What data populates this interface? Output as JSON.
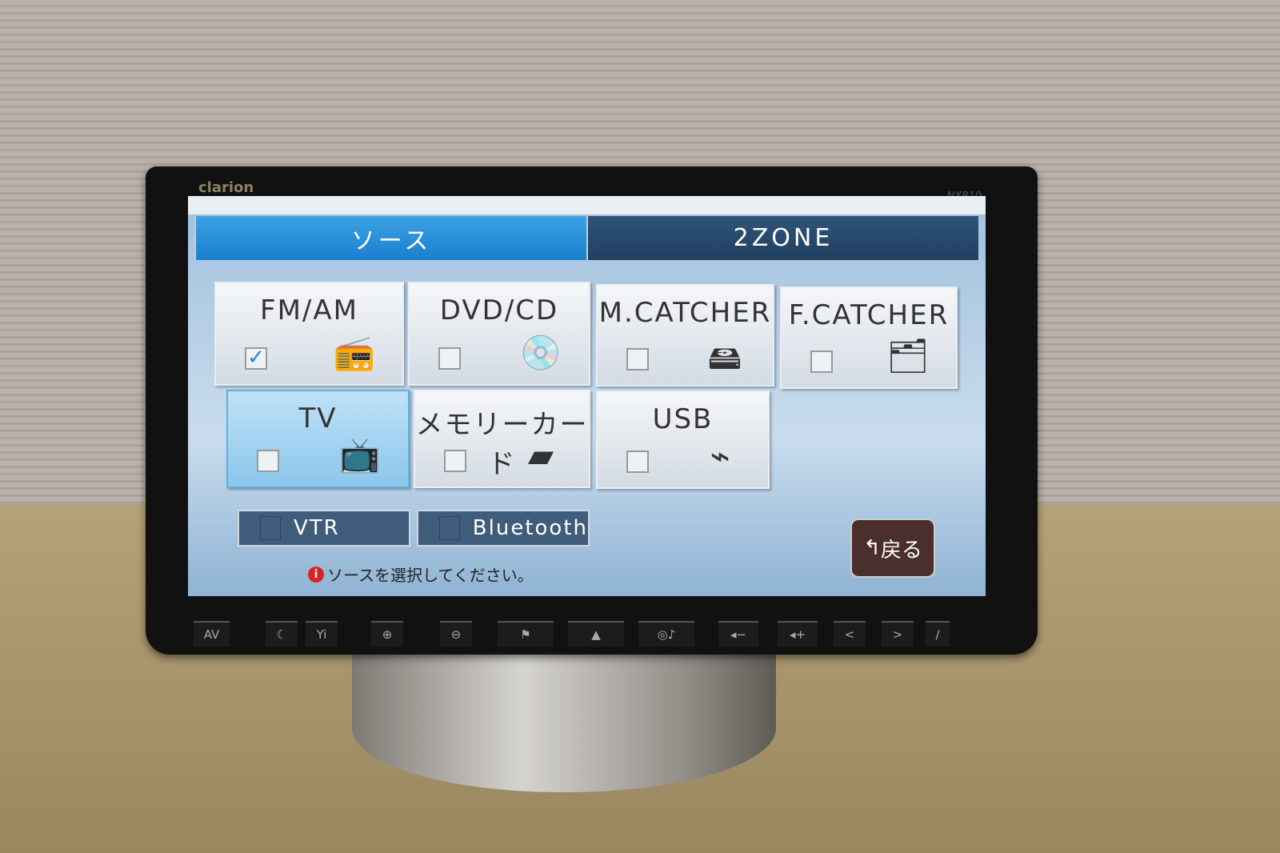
{
  "device": {
    "brand": "clarion",
    "model": "NX810"
  },
  "tabs": [
    {
      "label": "ソース",
      "active": true
    },
    {
      "label": "2ZONE",
      "active": false
    }
  ],
  "sources": [
    {
      "label": "FM/AM",
      "checked": true,
      "icon": "radio-icon",
      "glyph": "📻"
    },
    {
      "label": "DVD/CD",
      "checked": false,
      "icon": "disc-icon",
      "glyph": "💿"
    },
    {
      "label": "M.CATCHER",
      "checked": false,
      "icon": "music-hdd-icon",
      "glyph": "🖴"
    },
    {
      "label": "F.CATCHER",
      "checked": false,
      "icon": "file-hdd-icon",
      "glyph": "🗂"
    },
    {
      "label": "TV",
      "checked": false,
      "selected": true,
      "icon": "tv-icon",
      "glyph": "📺"
    },
    {
      "label": "メモリーカード",
      "checked": false,
      "icon": "sd-card-icon",
      "glyph": "▰"
    },
    {
      "label": "USB",
      "checked": false,
      "icon": "usb-icon",
      "glyph": "⌁"
    }
  ],
  "options": [
    {
      "label": "VTR"
    },
    {
      "label": "Bluetooth"
    }
  ],
  "back_label": "戻る",
  "back_glyph": "↰",
  "message": "ソースを選択してください。",
  "info_glyph": "i",
  "hardware_buttons": [
    "AV",
    "☾",
    "Yi",
    "⊕",
    "⊖",
    "⚑",
    "▲",
    "◎♪",
    "◂−",
    "◂+",
    "<",
    ">",
    "/"
  ],
  "colors": {
    "active_tab": "#1a7fcf",
    "tab_bar": "#20405f",
    "back_button": "#4a2f2c",
    "checkmark": "#1e88d6"
  }
}
